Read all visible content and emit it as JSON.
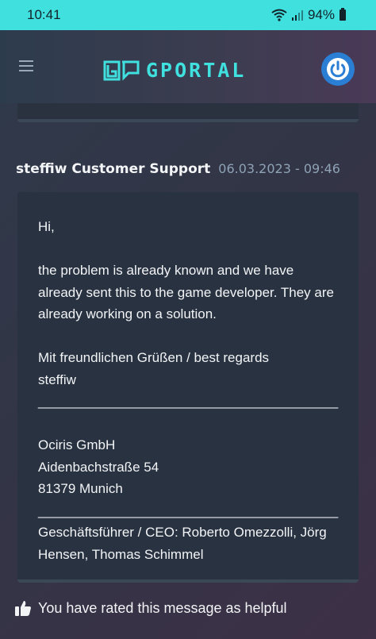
{
  "status": {
    "time": "10:41",
    "battery": "94%"
  },
  "header": {
    "brand": "GPORTAL"
  },
  "post": {
    "author": "steffiw Customer Support",
    "date": "06.03.2023 - 09:46",
    "lines": {
      "greeting": "Hi,",
      "b1": "the problem is already known and we have",
      "b2": "already sent this to the game developer. They are",
      "b3": "already working on a solution.",
      "regards": "Mit freundlichen Grüßen / best regards",
      "sig": "steffiw",
      "rule1": "________________________________________",
      "company": "Ociris GmbH",
      "street": "Aidenbachstraße 54",
      "city": "81379 Munich",
      "rule2": "________________________________________",
      "ceo1": "Geschäftsführer / CEO: Roberto Omezzolli, Jörg",
      "ceo2": "Hensen, Thomas Schimmel"
    }
  },
  "feedback": {
    "text": "You have rated this message as helpful"
  },
  "colors": {
    "accent": "#3fe0de",
    "power": "#2a7fd5"
  }
}
